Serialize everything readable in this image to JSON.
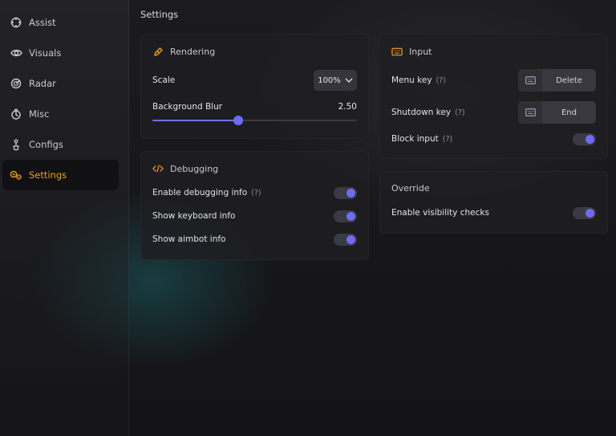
{
  "sidebar": {
    "items": [
      {
        "label": "Assist",
        "icon": "crosshair-icon"
      },
      {
        "label": "Visuals",
        "icon": "eye-icon"
      },
      {
        "label": "Radar",
        "icon": "radar-icon"
      },
      {
        "label": "Misc",
        "icon": "misc-icon"
      },
      {
        "label": "Configs",
        "icon": "configs-icon"
      },
      {
        "label": "Settings",
        "icon": "settings-icon",
        "active": true
      }
    ]
  },
  "header": {
    "title": "Settings"
  },
  "rendering": {
    "title": "Rendering",
    "scale_label": "Scale",
    "scale_value": "100%",
    "blur_label": "Background Blur",
    "blur_value": "2.50",
    "blur_fraction": 0.42
  },
  "debugging": {
    "title": "Debugging",
    "items": [
      {
        "label": "Enable debugging info",
        "help": "(?)",
        "enabled": true
      },
      {
        "label": "Show keyboard info",
        "enabled": true
      },
      {
        "label": "Show aimbot info",
        "enabled": true
      }
    ]
  },
  "input": {
    "title": "Input",
    "menu_key_label": "Menu key",
    "menu_key_help": "(?)",
    "menu_key_value": "Delete",
    "shutdown_key_label": "Shutdown key",
    "shutdown_key_help": "(?)",
    "shutdown_key_value": "End",
    "block_input_label": "Block input",
    "block_input_help": "(?)",
    "block_input_enabled": true
  },
  "override": {
    "title": "Override",
    "visibility_label": "Enable visibility checks",
    "visibility_enabled": true
  },
  "colors": {
    "accent": "#6f6cf2",
    "active": "#f0a020"
  }
}
